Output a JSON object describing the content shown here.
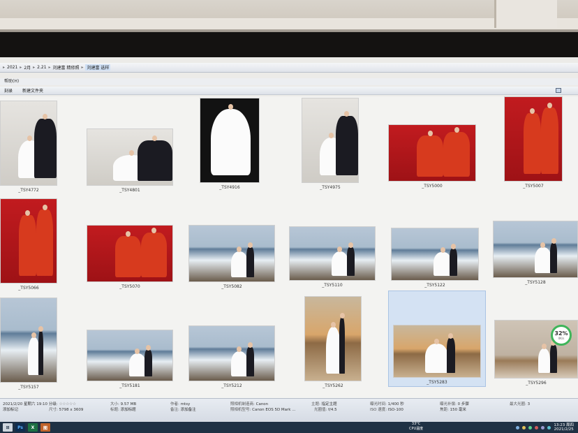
{
  "address": {
    "crumbs": [
      "2021",
      "2月",
      "2.21",
      "刘建富 精修照",
      "刘建富 选样"
    ]
  },
  "menu": {
    "help": "帮助(H)"
  },
  "toolbar": {
    "share": "刻录",
    "new_folder": "新建文件夹"
  },
  "thumbnails": [
    {
      "name": "_TSY4772",
      "style": "studio"
    },
    {
      "name": "_TSY4801",
      "style": "studio"
    },
    {
      "name": "_TSY4916",
      "style": "dark"
    },
    {
      "name": "_TSY4975",
      "style": "studio"
    },
    {
      "name": "_TSY5000",
      "style": "red"
    },
    {
      "name": "_TSY5007",
      "style": "red"
    },
    {
      "name": "_TSY5066",
      "style": "red"
    },
    {
      "name": "_TSY5070",
      "style": "red"
    },
    {
      "name": "_TSY5082",
      "style": "sea"
    },
    {
      "name": "_TSY5110",
      "style": "sea"
    },
    {
      "name": "_TSY5122",
      "style": "sea"
    },
    {
      "name": "_TSY5128",
      "style": "sea"
    },
    {
      "name": "_TSY5157",
      "style": "sea"
    },
    {
      "name": "_TSY5181",
      "style": "sea"
    },
    {
      "name": "_TSY5212",
      "style": "sea"
    },
    {
      "name": "_TSY5262",
      "style": "sunset"
    },
    {
      "name": "_TSY5283",
      "style": "sunset"
    },
    {
      "name": "_TSY5296",
      "style": "dune"
    }
  ],
  "overlay_meter": {
    "percent": "32%",
    "speed": "0K/s"
  },
  "status": {
    "date_taken": "2021/2/20 星期六 19:10 分级:",
    "stars": "☆☆☆☆☆",
    "tag_label": "添加标记",
    "size_k": "大小:",
    "size_v": "9.57 MB",
    "dims_k": "尺寸:",
    "dims_v": "5798 x 3609",
    "title_k": "标题:",
    "title_v": "添加标题",
    "author_k": "作者:",
    "author_v": "mtsy",
    "note_k": "备注:",
    "note_v": "添加备注",
    "maker_k": "照相机制造商:",
    "maker_v": "Canon",
    "model_k": "照相机型号:",
    "model_v": "Canon EOS 5D Mark ...",
    "subject_k": "主题:",
    "subject_v": "指定主题",
    "fstop_k": "光圈值:",
    "fstop_v": "f/4.5",
    "exposure_k": "曝光时间:",
    "exposure_v": "1/400 秒",
    "iso_k": "ISO 速度:",
    "iso_v": "ISO-100",
    "comp_k": "曝光补偿:",
    "comp_v": "0 步骤",
    "focal_k": "焦距:",
    "focal_v": "150 毫米",
    "maxap_k": "最大光圈:",
    "maxap_v": "3"
  },
  "taskbar": {
    "apps": [
      "Ps",
      "X",
      "图"
    ],
    "temp": "33°C",
    "cpu_label": "CPU温度",
    "time": "13:23 周四",
    "date": "2021/2/25"
  },
  "colors": {
    "accent": "#cfe0f5",
    "taskbar": "#1f3144",
    "meter": "#3fb55a"
  }
}
